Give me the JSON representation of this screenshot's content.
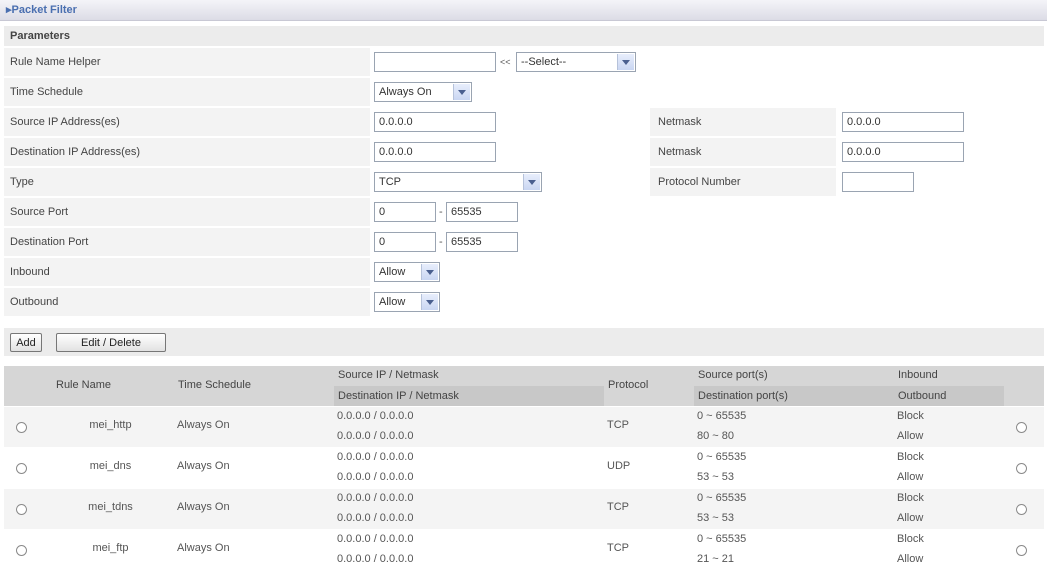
{
  "header": {
    "title": "Packet Filter"
  },
  "section": {
    "title": "Parameters"
  },
  "form": {
    "rule_name_helper": {
      "label": "Rule Name  Helper",
      "value": "",
      "arrows": "<<",
      "select": "--Select--"
    },
    "time_schedule": {
      "label": "Time Schedule",
      "select": "Always On"
    },
    "source_ip": {
      "label": "Source IP Address(es)",
      "value": "0.0.0.0",
      "netmask_label": "Netmask",
      "netmask": "0.0.0.0"
    },
    "destination_ip": {
      "label": "Destination IP Address(es)",
      "value": "0.0.0.0",
      "netmask_label": "Netmask",
      "netmask": "0.0.0.0"
    },
    "type": {
      "label": "Type",
      "select": "TCP",
      "protocol_label": "Protocol Number",
      "protocol_value": ""
    },
    "source_port": {
      "label": "Source Port",
      "from": "0",
      "to": "65535",
      "separator": "-"
    },
    "destination_port": {
      "label": "Destination Port",
      "from": "0",
      "to": "65535",
      "separator": "-"
    },
    "inbound": {
      "label": "Inbound",
      "select": "Allow"
    },
    "outbound": {
      "label": "Outbound",
      "select": "Allow"
    }
  },
  "buttons": {
    "add": "Add",
    "edit_delete": "Edit / Delete"
  },
  "table": {
    "headers": {
      "rule_name": "Rule Name",
      "time_schedule": "Time Schedule",
      "source_ip": "Source IP / Netmask",
      "destination_ip": "Destination IP / Netmask",
      "protocol": "Protocol",
      "source_ports": "Source port(s)",
      "destination_ports": "Destination port(s)",
      "inbound": "Inbound",
      "outbound": "Outbound"
    },
    "rows": [
      {
        "name": "mei_http",
        "schedule": "Always On",
        "src": "0.0.0.0 / 0.0.0.0",
        "dst": "0.0.0.0 / 0.0.0.0",
        "protocol": "TCP",
        "src_port": "0 ~ 65535",
        "dst_port": "80 ~ 80",
        "inbound": "Block",
        "outbound": "Allow"
      },
      {
        "name": "mei_dns",
        "schedule": "Always On",
        "src": "0.0.0.0 / 0.0.0.0",
        "dst": "0.0.0.0 / 0.0.0.0",
        "protocol": "UDP",
        "src_port": "0 ~ 65535",
        "dst_port": "53 ~ 53",
        "inbound": "Block",
        "outbound": "Allow"
      },
      {
        "name": "mei_tdns",
        "schedule": "Always On",
        "src": "0.0.0.0 / 0.0.0.0",
        "dst": "0.0.0.0 / 0.0.0.0",
        "protocol": "TCP",
        "src_port": "0 ~ 65535",
        "dst_port": "53 ~ 53",
        "inbound": "Block",
        "outbound": "Allow"
      },
      {
        "name": "mei_ftp",
        "schedule": "Always On",
        "src": "0.0.0.0 / 0.0.0.0",
        "dst": "0.0.0.0 / 0.0.0.0",
        "protocol": "TCP",
        "src_port": "0 ~ 65535",
        "dst_port": "21 ~ 21",
        "inbound": "Block",
        "outbound": "Allow"
      }
    ]
  }
}
